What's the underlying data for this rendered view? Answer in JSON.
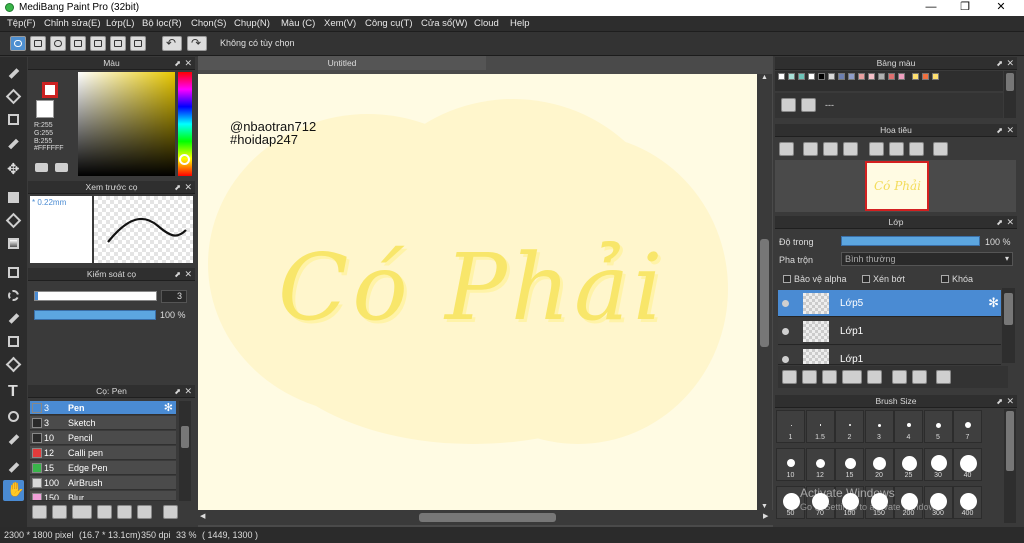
{
  "window": {
    "title": "MediBang Paint Pro (32bit)",
    "minimize": "—",
    "maximize": "❐",
    "close": "✕"
  },
  "menu": [
    "Tệp(F)",
    "Chỉnh sửa(E)",
    "Lớp(L)",
    "Bộ lọc(R)",
    "Chọn(S)",
    "Chụp(N)",
    "Màu (C)",
    "Xem(V)",
    "Công cụ(T)",
    "Cửa sổ(W)",
    "Cloud",
    "Help"
  ],
  "toolbar": {
    "option_label": "Không có tùy chọn"
  },
  "color_panel": {
    "title": "Màu",
    "r": "R:255",
    "g": "G:255",
    "b": "B:255",
    "hex": "#FFFFFF",
    "fg_color": "#cc2222",
    "bg_color": "#ffffff"
  },
  "brush_preview": {
    "title": "Xem trước cọ",
    "size": "0.22mm"
  },
  "brush_control": {
    "title": "Kiểm soát cọ",
    "size_value": "3",
    "opacity_value": "100 %"
  },
  "brush_list": {
    "title": "Cọ: Pen",
    "items": [
      {
        "size": "3",
        "name": "Pen",
        "color": "#4a8bd3",
        "selected": true
      },
      {
        "size": "3",
        "name": "Sketch",
        "color": "#2a2a2a"
      },
      {
        "size": "10",
        "name": "Pencil",
        "color": "#2a2a2a"
      },
      {
        "size": "12",
        "name": "Calli pen",
        "color": "#e23b3b"
      },
      {
        "size": "15",
        "name": "Edge Pen",
        "color": "#39b54a"
      },
      {
        "size": "100",
        "name": "AirBrush",
        "color": "#d8d8d8"
      },
      {
        "size": "150",
        "name": "Blur",
        "color": "#f0a0d8"
      }
    ]
  },
  "document": {
    "tab": "Untitled",
    "watermark_line1": "@nbaotran712",
    "watermark_line2": "#hoidap247",
    "lettering": "Có Phải"
  },
  "palette": {
    "title": "Bảng màu",
    "colors": [
      "#ffffff",
      "#a8e0d8",
      "#6cc3b8",
      "#ffffff",
      "#000000",
      "#d8d8d8",
      "#6c7fb0",
      "#8f9dc8",
      "#e8a0a0",
      "#f4c0c8",
      "#b0b0b0",
      "#e07070",
      "#f0a0c0",
      "#ffe070",
      "#f07040"
    ],
    "item_label": "---"
  },
  "navigator": {
    "title": "Hoa tiêu",
    "thumb_text": "Có Phải"
  },
  "layers": {
    "title": "Lớp",
    "opacity_label": "Độ trong",
    "opacity_value": "100 %",
    "blend_label": "Pha trộn",
    "blend_value": "Bình thường",
    "protect_alpha": "Bảo vệ alpha",
    "clipping": "Xén bớt",
    "lock": "Khóa",
    "items": [
      {
        "name": "Lớp5",
        "selected": true
      },
      {
        "name": "Lớp1",
        "selected": false
      },
      {
        "name": "Lớp1",
        "selected": false
      }
    ]
  },
  "brush_size": {
    "title": "Brush Size",
    "row1": [
      "1",
      "1.5",
      "2",
      "3",
      "4",
      "5",
      "7"
    ],
    "row2": [
      "10",
      "12",
      "15",
      "20",
      "25",
      "30",
      "40"
    ],
    "row3": [
      "50",
      "70",
      "100",
      "150",
      "200",
      "300",
      "400"
    ]
  },
  "status": {
    "pixels": "2300 * 1800 pixel",
    "cm": "(16.7 * 13.1cm)",
    "dpi": "350 dpi",
    "zoom": "33 %",
    "coords": "( 1449, 1300 )"
  },
  "os_watermark": {
    "line1": "Activate Windows",
    "line2": "Go to Settings to activate Windows"
  }
}
